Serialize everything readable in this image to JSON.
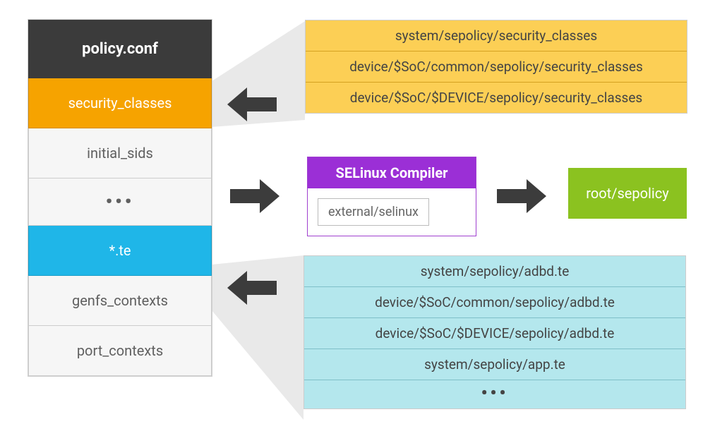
{
  "policy_stack": {
    "header": "policy.conf",
    "rows": [
      {
        "label": "security_classes",
        "style": "orange"
      },
      {
        "label": "initial_sids",
        "style": "plain"
      },
      {
        "label": "•••",
        "style": "dots"
      },
      {
        "label": "*.te",
        "style": "blue"
      },
      {
        "label": "genfs_contexts",
        "style": "plain"
      },
      {
        "label": "port_contexts",
        "style": "plain"
      }
    ]
  },
  "security_classes_sources": {
    "rows": [
      "system/sepolicy/security_classes",
      "device/$SoC/common/sepolicy/security_classes",
      "device/$SoC/$DEVICE/sepolicy/security_classes"
    ]
  },
  "te_sources": {
    "rows": [
      "system/sepolicy/adbd.te",
      "device/$SoC/common/sepolicy/adbd.te",
      "device/$SoC/$DEVICE/sepolicy/adbd.te",
      "system/sepolicy/app.te",
      "•••"
    ]
  },
  "compiler": {
    "title": "SELinux Compiler",
    "path": "external/selinux"
  },
  "output": {
    "label": "root/sepolicy"
  },
  "colors": {
    "dark": "#3b3b3b",
    "orange": "#f6a300",
    "orange_light": "#fccf55",
    "blue": "#1fb6e8",
    "cyan_light": "#b4e7ed",
    "purple": "#9b2fd6",
    "green": "#8bc220",
    "grey_bg": "#e9e9e9"
  }
}
